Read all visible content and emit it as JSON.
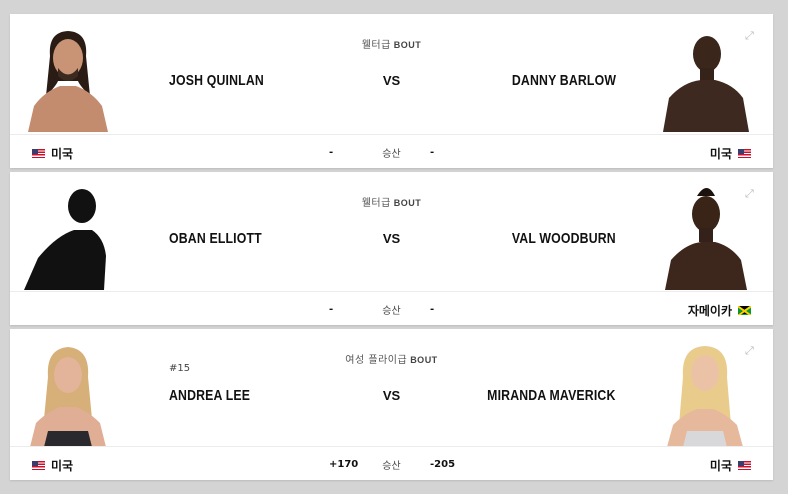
{
  "bouts": [
    {
      "weight_class": "웰터급",
      "bout_word": "BOUT",
      "left": {
        "name": "JOSH QUINLAN",
        "country": "미국",
        "flag": "us",
        "odds": "-",
        "rank": ""
      },
      "right": {
        "name": "DANNY BARLOW",
        "country": "미국",
        "flag": "us",
        "odds": "-"
      },
      "vs": "VS",
      "result": "승산"
    },
    {
      "weight_class": "웰터급",
      "bout_word": "BOUT",
      "left": {
        "name": "OBAN ELLIOTT",
        "country": "",
        "flag": "",
        "odds": "-",
        "rank": ""
      },
      "right": {
        "name": "VAL WOODBURN",
        "country": "자메이카",
        "flag": "jm",
        "odds": "-"
      },
      "vs": "VS",
      "result": "승산"
    },
    {
      "weight_class": "여성 플라이급",
      "bout_word": "BOUT",
      "left": {
        "name": "ANDREA LEE",
        "country": "미국",
        "flag": "us",
        "odds": "+170",
        "rank": "#15"
      },
      "right": {
        "name": "MIRANDA MAVERICK",
        "country": "미국",
        "flag": "us",
        "odds": "-205"
      },
      "vs": "VS",
      "result": "승산"
    }
  ],
  "icons": {
    "expand": "expand-icon",
    "flag_us": "us-flag-icon",
    "flag_jm": "jamaica-flag-icon"
  },
  "colors": {
    "card_bg": "#ffffff",
    "page_bg": "#d4d4d4",
    "text": "#111111"
  }
}
